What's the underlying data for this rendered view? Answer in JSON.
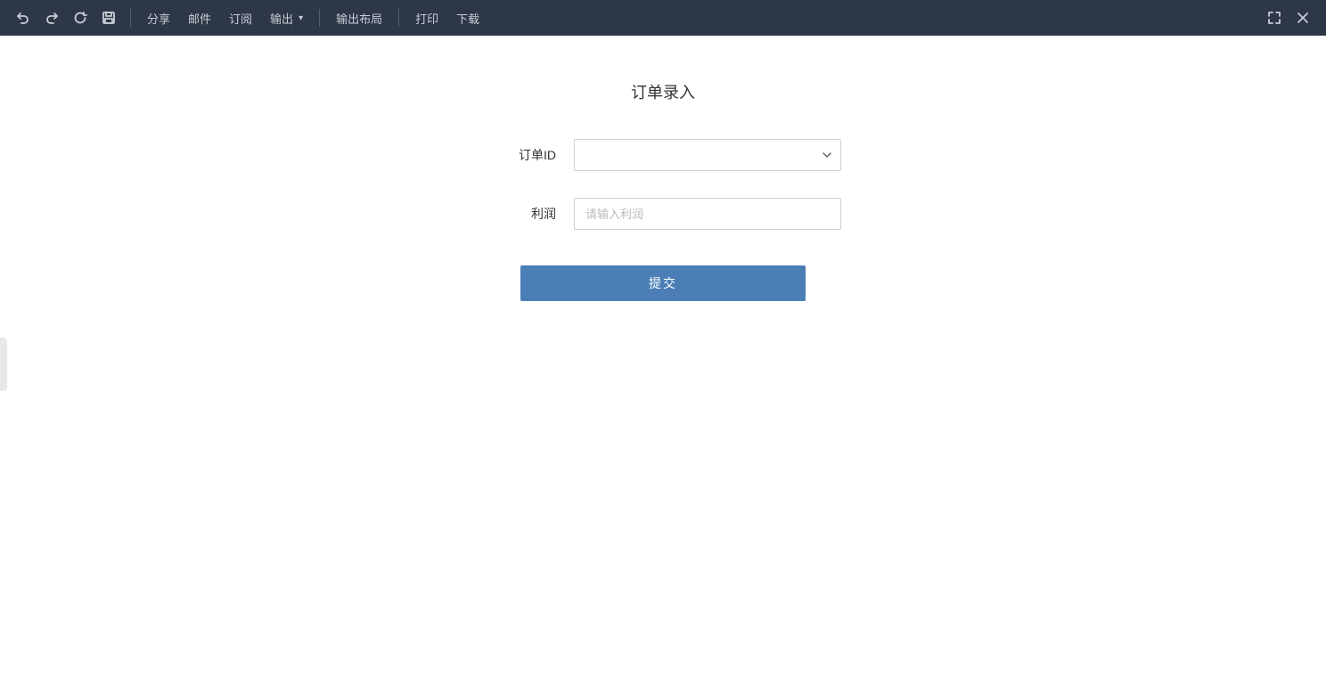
{
  "toolbar": {
    "undo_title": "撤销",
    "redo_title": "重做",
    "refresh_title": "刷新",
    "save_title": "保存",
    "share_label": "分享",
    "mail_label": "邮件",
    "subscribe_label": "订阅",
    "export_label": "输出",
    "layout_label": "输出布局",
    "print_label": "打印",
    "download_label": "下载",
    "fullscreen_title": "全屏",
    "close_title": "关闭"
  },
  "form": {
    "title": "订单录入",
    "order_id_label": "订单ID",
    "order_id_placeholder": "",
    "profit_label": "利润",
    "profit_placeholder": "请输入利润",
    "submit_label": "提交"
  }
}
